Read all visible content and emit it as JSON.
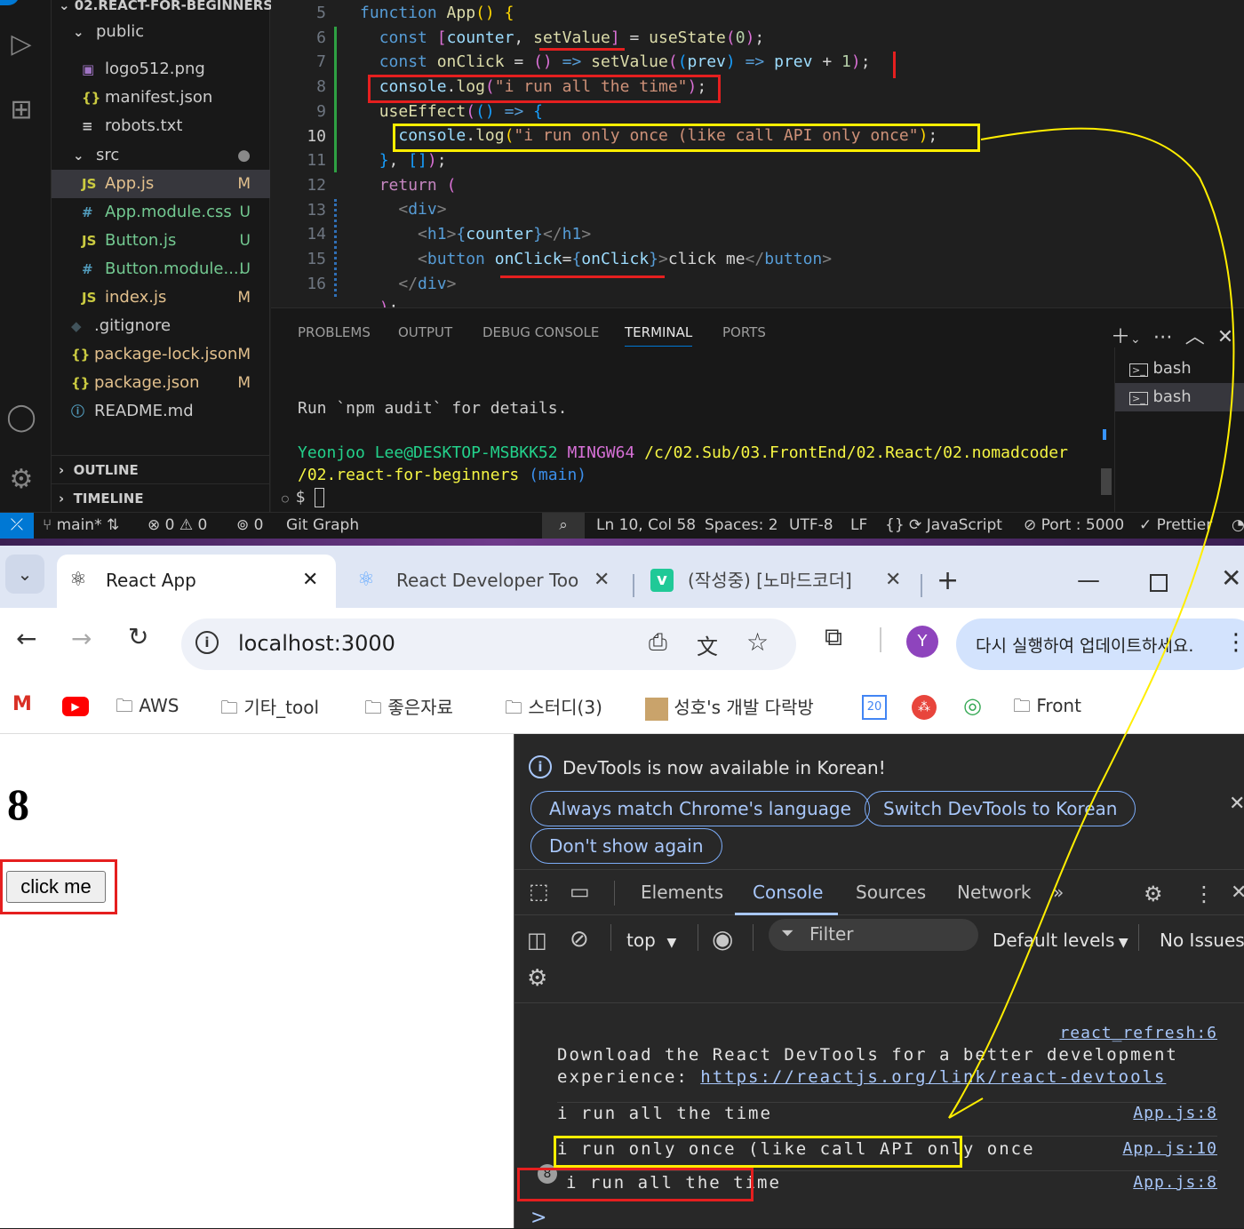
{
  "vscode": {
    "explorer": {
      "root": "02.REACT-FOR-BEGINNERS",
      "items": [
        {
          "name": "public",
          "status": "",
          "type": "folder"
        },
        {
          "name": "logo512.png",
          "status": "",
          "type": "image"
        },
        {
          "name": "manifest.json",
          "status": "",
          "type": "json"
        },
        {
          "name": "robots.txt",
          "status": "",
          "type": "text"
        },
        {
          "name": "src",
          "status": "●",
          "type": "folder"
        },
        {
          "name": "App.js",
          "status": "M",
          "type": "js"
        },
        {
          "name": "App.module.css",
          "status": "U",
          "type": "css"
        },
        {
          "name": "Button.js",
          "status": "U",
          "type": "js"
        },
        {
          "name": "Button.module....",
          "status": "U",
          "type": "css"
        },
        {
          "name": "index.js",
          "status": "M",
          "type": "js"
        },
        {
          "name": ".gitignore",
          "status": "",
          "type": "git"
        },
        {
          "name": "package-lock.json",
          "status": "M",
          "type": "json"
        },
        {
          "name": "package.json",
          "status": "M",
          "type": "json"
        },
        {
          "name": "README.md",
          "status": "",
          "type": "info"
        }
      ],
      "outline": "OUTLINE",
      "timeline": "TIMELINE"
    },
    "editor": {
      "line_numbers": [
        "5",
        "6",
        "7",
        "8",
        "9",
        "10",
        "11",
        "12",
        "13",
        "14",
        "15",
        "16"
      ],
      "current_line": "10"
    },
    "panel": {
      "tabs": [
        "PROBLEMS",
        "OUTPUT",
        "DEBUG CONSOLE",
        "TERMINAL",
        "PORTS"
      ],
      "active_tab": "TERMINAL",
      "terminals": [
        "bash",
        "bash"
      ],
      "lines": {
        "audit": "Run `npm audit` for details.",
        "user": "Yeonjoo Lee@DESKTOP-MSBKK52",
        "shell": "MINGW64",
        "path1": "/c/02.Sub/03.FrontEnd/02.React/02.nomadcoder",
        "path2": "/02.react-for-beginners",
        "branch": "(main)",
        "prompt": "$"
      }
    },
    "statusbar": {
      "branch": "main*",
      "errors": "0",
      "warnings": "0",
      "ports": "0",
      "git_graph": "Git Graph",
      "position": "Ln 10, Col 58",
      "spaces": "Spaces: 2",
      "encoding": "UTF-8",
      "eol": "LF",
      "language": "JavaScript",
      "port": "Port : 5000",
      "prettier": "Prettier"
    }
  },
  "chrome": {
    "tabs": [
      {
        "title": "React App",
        "active": true
      },
      {
        "title": "React Developer Tool",
        "active": false
      },
      {
        "title": "(작성중) [노마드코더]",
        "active": false
      }
    ],
    "url": "localhost:3000",
    "avatar_letter": "Y",
    "update_text": "다시 실행하여 업데이트하세요.",
    "bookmarks": [
      "AWS",
      "기타_tool",
      "좋은자료",
      "스터디(3)",
      "성호's 개발 다락방",
      "Front"
    ],
    "calendar_day": "20"
  },
  "page": {
    "counter": "8",
    "button_label": "click me"
  },
  "devtools": {
    "banner": "DevTools is now available in Korean!",
    "buttons": [
      "Always match Chrome's language",
      "Switch DevTools to Korean",
      "Don't show again"
    ],
    "tabs": [
      "Elements",
      "Console",
      "Sources",
      "Network"
    ],
    "active_tab": "Console",
    "context": "top",
    "filter_placeholder": "Filter",
    "levels": "Default levels",
    "issues": "No Issues",
    "messages": [
      {
        "text": "Download the React DevTools for a better development",
        "text2": "experience: ",
        "link": "https://reactjs.org/link/react-devtools",
        "source": "react_refresh:6",
        "count": ""
      },
      {
        "text": "i run all the time",
        "source": "App.js:8",
        "count": ""
      },
      {
        "text": "i run only once (like call API only once",
        "source": "App.js:10",
        "count": ""
      },
      {
        "text": "i run all the time",
        "source": "App.js:8",
        "count": "8"
      }
    ],
    "prompt": ">"
  }
}
